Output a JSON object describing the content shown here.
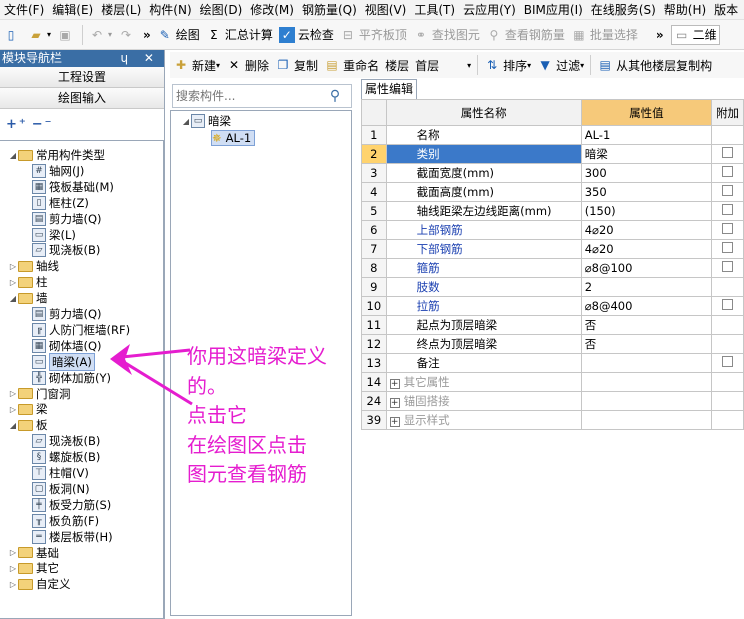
{
  "menu": [
    "文件(F)",
    "编辑(E)",
    "楼层(L)",
    "构件(N)",
    "绘图(D)",
    "修改(M)",
    "钢筋量(Q)",
    "视图(V)",
    "工具(T)",
    "云应用(Y)",
    "BIM应用(I)",
    "在线服务(S)",
    "帮助(H)",
    "版本"
  ],
  "toolbar": {
    "draw": "绘图",
    "sum": "汇总计算",
    "cloud_check": "云检查",
    "flat_top": "平齐板顶",
    "find_element": "查找图元",
    "view_rebar": "查看钢筋量",
    "batch_select": "批量选择",
    "right_text": "二维"
  },
  "nav": {
    "title": "模块导航栏",
    "pin": "ɥ ✕",
    "project_settings": "工程设置",
    "draw_input": "绘图输入"
  },
  "tree": [
    {
      "label": "常用构件类型",
      "level": 0,
      "type": "folder",
      "toggle": "◢"
    },
    {
      "label": "轴网(J)",
      "level": 1,
      "type": "comp",
      "glyph": "#"
    },
    {
      "label": "筏板基础(M)",
      "level": 1,
      "type": "comp",
      "glyph": "▦"
    },
    {
      "label": "框柱(Z)",
      "level": 1,
      "type": "comp",
      "glyph": "▯"
    },
    {
      "label": "剪力墙(Q)",
      "level": 1,
      "type": "comp",
      "glyph": "▤"
    },
    {
      "label": "梁(L)",
      "level": 1,
      "type": "comp",
      "glyph": "▭"
    },
    {
      "label": "现浇板(B)",
      "level": 1,
      "type": "comp",
      "glyph": "▱"
    },
    {
      "label": "轴线",
      "level": 0,
      "type": "folder",
      "toggle": "▷"
    },
    {
      "label": "柱",
      "level": 0,
      "type": "folder",
      "toggle": "▷"
    },
    {
      "label": "墙",
      "level": 0,
      "type": "folder",
      "toggle": "◢"
    },
    {
      "label": "剪力墙(Q)",
      "level": 1,
      "type": "comp",
      "glyph": "▤"
    },
    {
      "label": "人防门框墙(RF)",
      "level": 1,
      "type": "comp",
      "glyph": "╔"
    },
    {
      "label": "砌体墙(Q)",
      "level": 1,
      "type": "comp",
      "glyph": "▦"
    },
    {
      "label": "暗梁(A)",
      "level": 1,
      "type": "comp",
      "glyph": "▭",
      "selected": true
    },
    {
      "label": "砌体加筋(Y)",
      "level": 1,
      "type": "comp",
      "glyph": "╬"
    },
    {
      "label": "门窗洞",
      "level": 0,
      "type": "folder",
      "toggle": "▷"
    },
    {
      "label": "梁",
      "level": 0,
      "type": "folder",
      "toggle": "▷"
    },
    {
      "label": "板",
      "level": 0,
      "type": "folder",
      "toggle": "◢"
    },
    {
      "label": "现浇板(B)",
      "level": 1,
      "type": "comp",
      "glyph": "▱"
    },
    {
      "label": "螺旋板(B)",
      "level": 1,
      "type": "comp",
      "glyph": "§"
    },
    {
      "label": "柱帽(V)",
      "level": 1,
      "type": "comp",
      "glyph": "⊤"
    },
    {
      "label": "板洞(N)",
      "level": 1,
      "type": "comp",
      "glyph": "▢"
    },
    {
      "label": "板受力筋(S)",
      "level": 1,
      "type": "comp",
      "glyph": "╪"
    },
    {
      "label": "板负筋(F)",
      "level": 1,
      "type": "comp",
      "glyph": "╥"
    },
    {
      "label": "楼层板带(H)",
      "level": 1,
      "type": "comp",
      "glyph": "═"
    },
    {
      "label": "基础",
      "level": 0,
      "type": "folder",
      "toggle": "▷"
    },
    {
      "label": "其它",
      "level": 0,
      "type": "folder",
      "toggle": "▷"
    },
    {
      "label": "自定义",
      "level": 0,
      "type": "folder",
      "toggle": "▷"
    }
  ],
  "mid_toolbar": {
    "new": "新建",
    "delete": "删除",
    "copy": "复制",
    "rename": "重命名",
    "floor_label": "楼层",
    "floor_value": "首层",
    "sort": "排序",
    "filter": "过滤",
    "copy_from_other": "从其他楼层复制构"
  },
  "search": {
    "placeholder": "搜索构件..."
  },
  "component_tree": {
    "root": "暗梁",
    "child": "AL-1"
  },
  "prop_tab": "属性编辑",
  "prop_headers": {
    "name": "属性名称",
    "value": "属性值",
    "extra": "附加"
  },
  "props": [
    {
      "n": "1",
      "name": "名称",
      "value": "AL-1",
      "style": "",
      "check": false,
      "plus": false
    },
    {
      "n": "2",
      "name": "类别",
      "value": "暗梁",
      "style": "sel",
      "check": true,
      "plus": false
    },
    {
      "n": "3",
      "name": "截面宽度(mm)",
      "value": "300",
      "style": "",
      "check": true,
      "plus": false
    },
    {
      "n": "4",
      "name": "截面高度(mm)",
      "value": "350",
      "style": "",
      "check": true,
      "plus": false
    },
    {
      "n": "5",
      "name": "轴线距梁左边线距离(mm)",
      "value": "(150)",
      "style": "",
      "check": true,
      "plus": false
    },
    {
      "n": "6",
      "name": "上部钢筋",
      "value": "4⌀20",
      "style": "blue",
      "check": true,
      "plus": false
    },
    {
      "n": "7",
      "name": "下部钢筋",
      "value": "4⌀20",
      "style": "blue",
      "check": true,
      "plus": false
    },
    {
      "n": "8",
      "name": "箍筋",
      "value": "⌀8@100",
      "style": "blue",
      "check": true,
      "plus": false
    },
    {
      "n": "9",
      "name": "肢数",
      "value": "2",
      "style": "blue",
      "check": false,
      "plus": false
    },
    {
      "n": "10",
      "name": "拉筋",
      "value": "⌀8@400",
      "style": "blue",
      "check": true,
      "plus": false
    },
    {
      "n": "11",
      "name": "起点为顶层暗梁",
      "value": "否",
      "style": "",
      "check": false,
      "plus": false
    },
    {
      "n": "12",
      "name": "终点为顶层暗梁",
      "value": "否",
      "style": "",
      "check": false,
      "plus": false
    },
    {
      "n": "13",
      "name": "备注",
      "value": "",
      "style": "",
      "check": true,
      "plus": false
    },
    {
      "n": "14",
      "name": "其它属性",
      "value": "",
      "style": "grey",
      "check": false,
      "plus": true
    },
    {
      "n": "24",
      "name": "锚固搭接",
      "value": "",
      "style": "grey",
      "check": false,
      "plus": true
    },
    {
      "n": "39",
      "name": "显示样式",
      "value": "",
      "style": "grey",
      "check": false,
      "plus": true
    }
  ],
  "annotation": [
    "你用这暗梁定义",
    "的。",
    "点击它",
    "在绘图区点击",
    "图元查看钢筋"
  ],
  "colors": {
    "annotation": "#e51dcf",
    "selection": "#3b79c9",
    "header_value": "#f6c97a"
  }
}
